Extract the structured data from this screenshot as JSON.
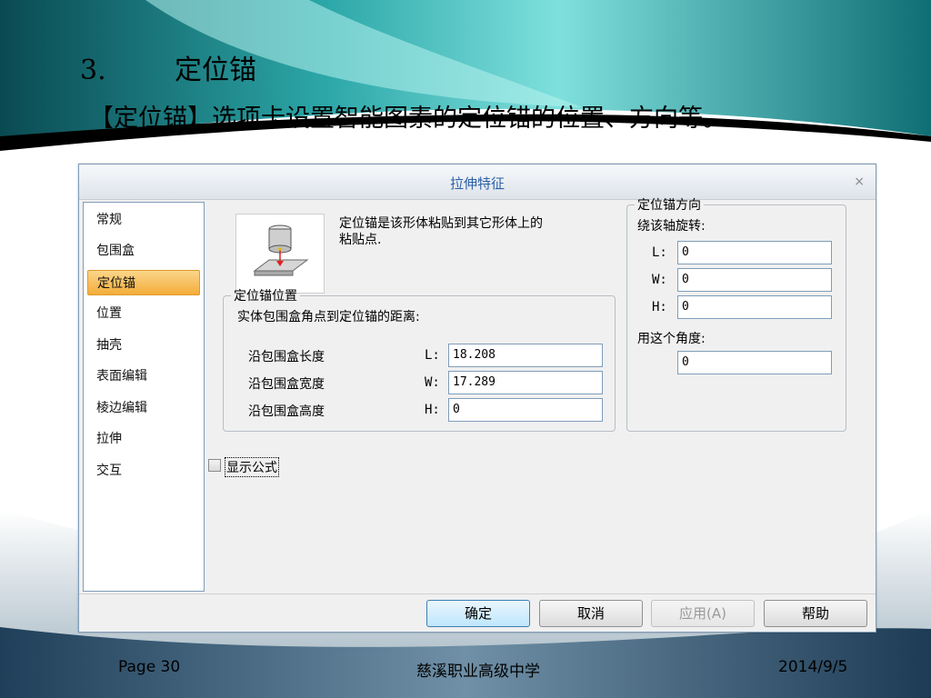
{
  "slide": {
    "number": "3.",
    "title": "定位锚",
    "subtitle": "【定位锚】选项卡设置智能图素的定位锚的位置、方向等。"
  },
  "dialog": {
    "title": "拉伸特征",
    "close_icon": "×",
    "nav": [
      "常规",
      "包围盒",
      "定位锚",
      "位置",
      "抽壳",
      "表面编辑",
      "棱边编辑",
      "拉伸",
      "交互"
    ],
    "active_nav": "定位锚",
    "description": "定位锚是该形体粘贴到其它形体上的粘贴点.",
    "position": {
      "legend": "定位锚位置",
      "intro": "实体包围盒角点到定位锚的距离:",
      "rows": [
        {
          "label": "沿包围盒长度",
          "axis": "L:",
          "value": "18.208"
        },
        {
          "label": "沿包围盒宽度",
          "axis": "W:",
          "value": "17.289"
        },
        {
          "label": "沿包围盒高度",
          "axis": "H:",
          "value": "0"
        }
      ]
    },
    "direction": {
      "legend": "定位锚方向",
      "axis_title": "绕该轴旋转:",
      "rows": [
        {
          "axis": "L:",
          "value": "0"
        },
        {
          "axis": "W:",
          "value": "0"
        },
        {
          "axis": "H:",
          "value": "0"
        }
      ],
      "angle_label": "用这个角度:",
      "angle_value": "0"
    },
    "show_formula": "显示公式",
    "buttons": {
      "ok": "确定",
      "cancel": "取消",
      "apply": "应用(A)",
      "help": "帮助"
    }
  },
  "footer": {
    "page": "Page 30",
    "school": "慈溪职业高级中学",
    "date": "2014/9/5"
  },
  "colors": {
    "teal_dark": "#0f5f66",
    "teal_light": "#8fe3e3",
    "nav_active": "#f3ad3a",
    "title_text": "#2b5fa7"
  }
}
